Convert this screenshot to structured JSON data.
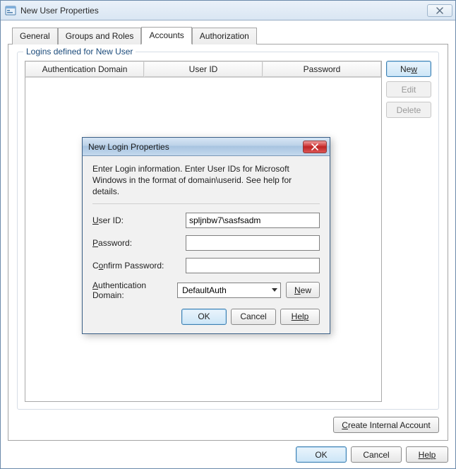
{
  "window": {
    "title": "New User Properties"
  },
  "tabs": [
    {
      "label": "General"
    },
    {
      "label": "Groups and Roles"
    },
    {
      "label": "Accounts"
    },
    {
      "label": "Authorization"
    }
  ],
  "group": {
    "legend": "Logins defined for New User",
    "columns": [
      "Authentication Domain",
      "User ID",
      "Password"
    ]
  },
  "sideButtons": {
    "new": "New",
    "edit": "Edit",
    "delete": "Delete"
  },
  "createInternal": "Create Internal Account",
  "footer": {
    "ok": "OK",
    "cancel": "Cancel",
    "help": "Help"
  },
  "modal": {
    "title": "New Login Properties",
    "instruction": "Enter Login information. Enter User IDs for Microsoft Windows in the format of domain\\userid. See help for details.",
    "labels": {
      "userId": "User ID:",
      "password": "Password:",
      "confirm": "Confirm Password:",
      "authDomain": "Authentication Domain:"
    },
    "fields": {
      "userId": "spljnbw7\\sasfsadm",
      "password": "",
      "confirm": "",
      "authDomain": "DefaultAuth"
    },
    "newBtn": "New",
    "footer": {
      "ok": "OK",
      "cancel": "Cancel",
      "help": "Help"
    }
  }
}
